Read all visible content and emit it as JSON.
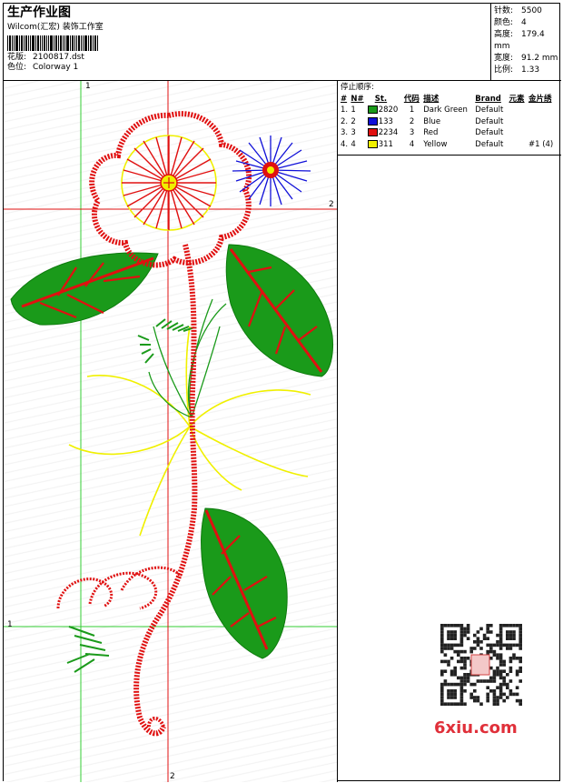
{
  "header": {
    "title": "生产作业图",
    "company": "Wilcom(汇宏) 装饰工作室",
    "design_label": "花版:",
    "design_file": "2100817.dst",
    "colorway_label": "色位:",
    "colorway": "Colorway 1"
  },
  "stats": [
    {
      "label": "针数:",
      "value": "5500"
    },
    {
      "label": "颜色:",
      "value": "4"
    },
    {
      "label": "高度:",
      "value": "179.4 mm"
    },
    {
      "label": "宽度:",
      "value": "91.2 mm"
    },
    {
      "label": "比例:",
      "value": "1.33"
    }
  ],
  "stop_sequence": {
    "title": "停止顺序:",
    "headers": [
      "#",
      "N#",
      "St.",
      "代码",
      "描述",
      "Brand",
      "元素",
      "金片绣"
    ],
    "rows": [
      {
        "num": "1.",
        "n": "1",
        "color": "#1a9a1a",
        "code": "2820",
        "code2": "1",
        "desc": "Dark Green",
        "brand": "Default",
        "elem": "",
        "seq": ""
      },
      {
        "num": "2.",
        "n": "2",
        "color": "#1010d8",
        "code": "133",
        "code2": "2",
        "desc": "Blue",
        "brand": "Default",
        "elem": "",
        "seq": ""
      },
      {
        "num": "3.",
        "n": "3",
        "color": "#e01010",
        "code": "2234",
        "code2": "3",
        "desc": "Red",
        "brand": "Default",
        "elem": "",
        "seq": ""
      },
      {
        "num": "4.",
        "n": "4",
        "color": "#f0f000",
        "code": "311",
        "code2": "4",
        "desc": "Yellow",
        "brand": "Default",
        "elem": "",
        "seq": "#1 (4)"
      }
    ]
  },
  "axes": {
    "v1": "1",
    "h2": "2",
    "h1": "1",
    "v2": "2"
  },
  "watermark": "6xiu.com",
  "colors": {
    "green": "#1a9a1a",
    "blue": "#1010d8",
    "red": "#e01010",
    "yellow": "#f0f000",
    "guide_green": "#33cc33",
    "guide_red": "#e01010"
  }
}
